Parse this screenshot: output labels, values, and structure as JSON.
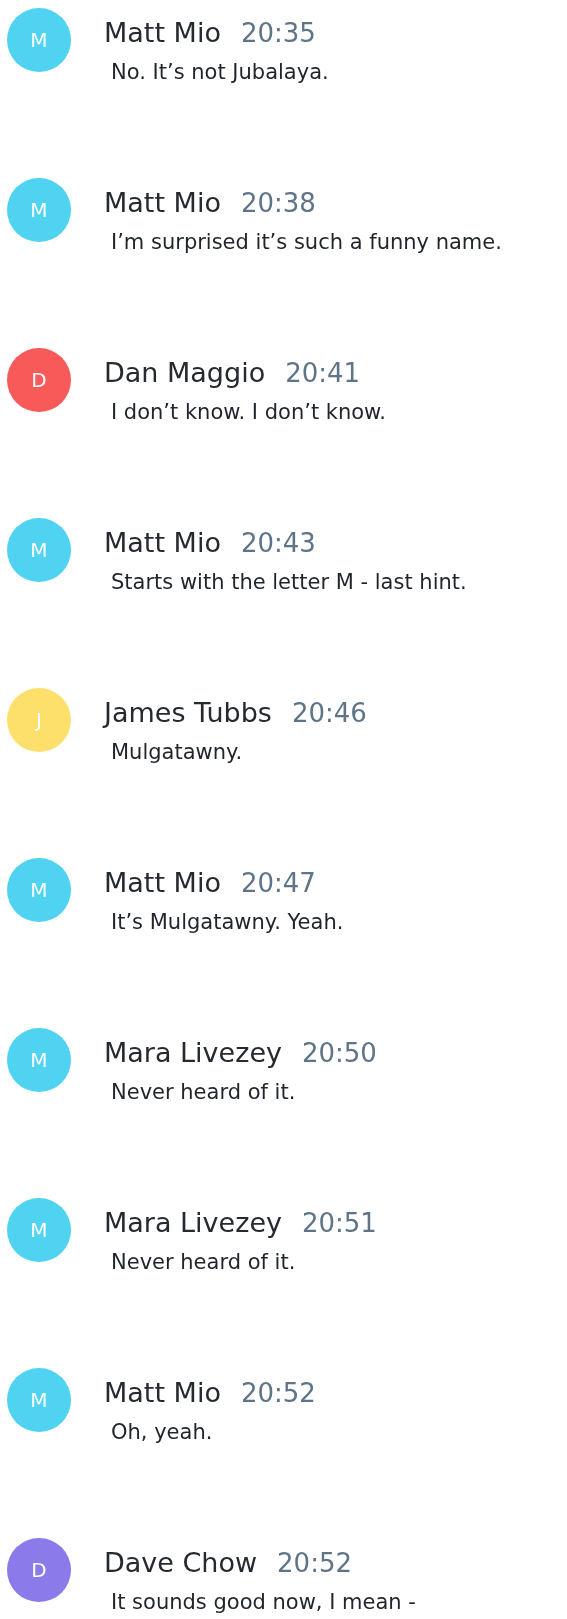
{
  "messages": [
    {
      "initial": "M",
      "color": "#4fd3f1",
      "name": "Matt Mio",
      "time": "20:35",
      "text": "No. It’s not Jubalaya."
    },
    {
      "initial": "M",
      "color": "#4fd3f1",
      "name": "Matt Mio",
      "time": "20:38",
      "text": "I’m surprised it’s such a funny name."
    },
    {
      "initial": "D",
      "color": "#f85a5a",
      "name": "Dan Maggio",
      "time": "20:41",
      "text": "I don’t know. I don’t know."
    },
    {
      "initial": "M",
      "color": "#4fd3f1",
      "name": "Matt Mio",
      "time": "20:43",
      "text": "Starts with the letter M - last hint."
    },
    {
      "initial": "J",
      "color": "#fde06c",
      "name": "James Tubbs",
      "time": "20:46",
      "text": "Mulgatawny."
    },
    {
      "initial": "M",
      "color": "#4fd3f1",
      "name": "Matt Mio",
      "time": "20:47",
      "text": "It’s Mulgatawny. Yeah."
    },
    {
      "initial": "M",
      "color": "#4fd3f1",
      "name": "Mara Livezey",
      "time": "20:50",
      "text": "Never heard of it."
    },
    {
      "initial": "M",
      "color": "#4fd3f1",
      "name": "Mara Livezey",
      "time": "20:51",
      "text": "Never heard of it."
    },
    {
      "initial": "M",
      "color": "#4fd3f1",
      "name": "Matt Mio",
      "time": "20:52",
      "text": "Oh, yeah."
    },
    {
      "initial": "D",
      "color": "#8a7aea",
      "name": "Dave Chow",
      "time": "20:52",
      "text": "It sounds good now, I mean -"
    }
  ]
}
